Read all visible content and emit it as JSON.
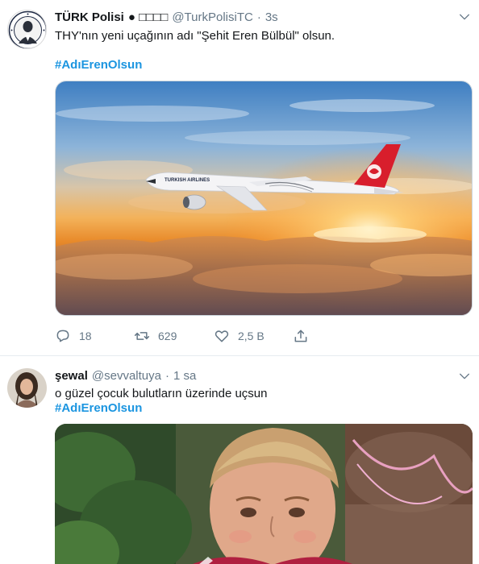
{
  "tweets": [
    {
      "display_name": "TÜRK Polisi",
      "badge": "● □□□□",
      "handle": "@TurkPolisiTC",
      "separator": "·",
      "time": "3s",
      "text": "THY'nın yeni uçağının adı \"Şehit Eren Bülbül\" olsun.",
      "hashtag": "#AdıErenOlsun",
      "media": {
        "airline_label": "TURKISH AIRLINES"
      },
      "actions": {
        "replies": "18",
        "retweets": "629",
        "likes": "2,5 B"
      }
    },
    {
      "display_name": "şewal",
      "handle": "@sevvaltuya",
      "separator": "·",
      "time": "1 sa",
      "text": "o güzel çocuk bulutların üzerinde uçsun",
      "hashtag": "#AdıErenOlsun"
    }
  ],
  "colors": {
    "hashtag": "#1b95e0",
    "muted": "#657786",
    "divider": "#e6ecf0"
  },
  "icons": [
    "reply-icon",
    "retweet-icon",
    "like-icon",
    "share-icon",
    "chevron-down-icon"
  ]
}
